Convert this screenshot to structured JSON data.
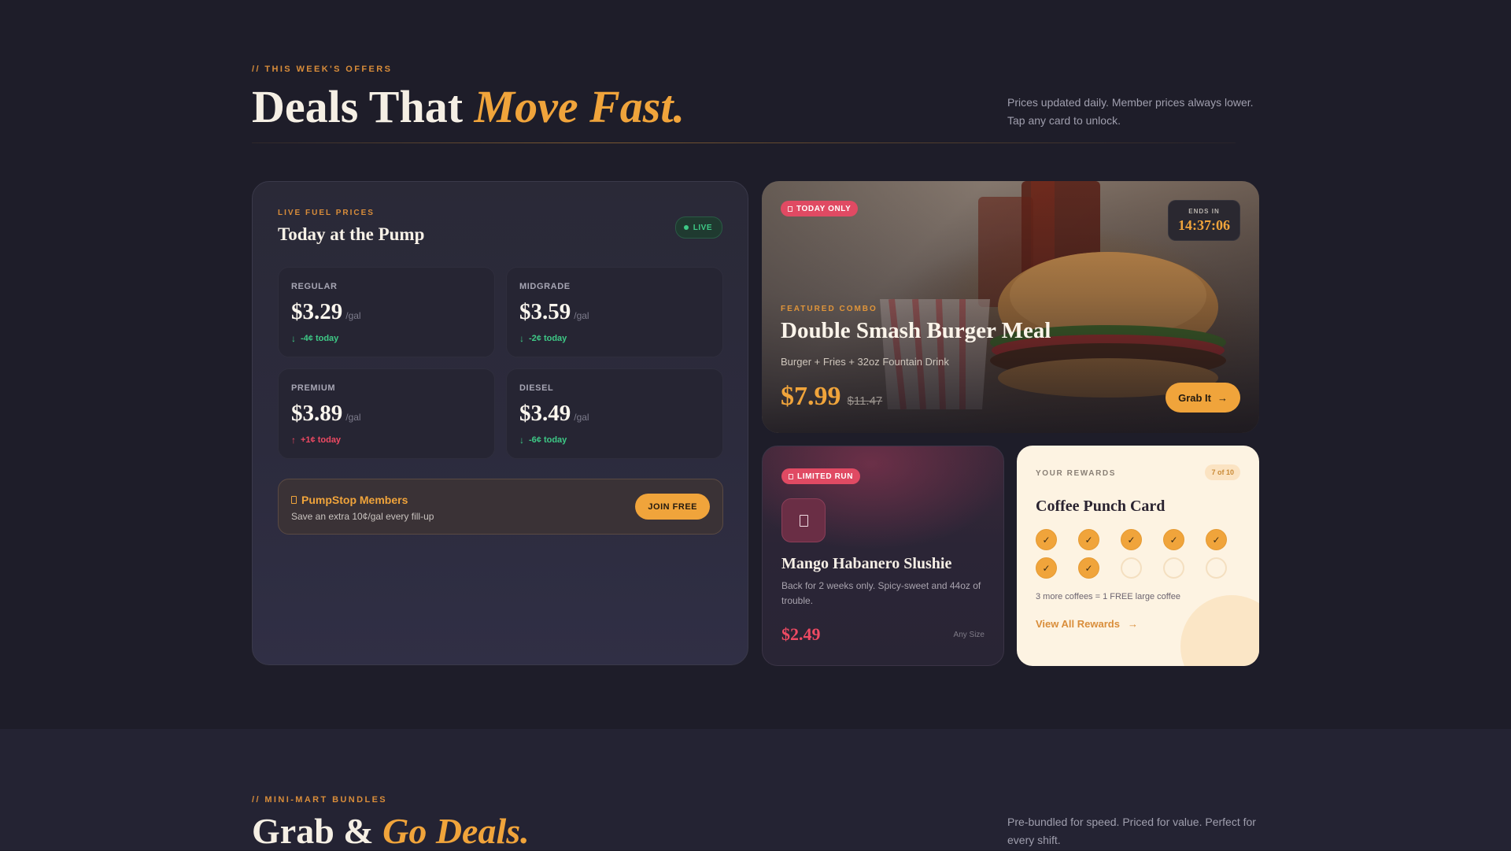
{
  "offers_section": {
    "eyebrow": "// THIS WEEK'S OFFERS",
    "title_plain": "Deals That ",
    "title_accent": "Move Fast.",
    "note": "Prices updated daily. Member prices always lower. Tap any card to unlock."
  },
  "fuel_card": {
    "eyebrow": "LIVE FUEL PRICES",
    "title": "Today at the Pump",
    "live_label": "LIVE",
    "prices": [
      {
        "grade": "REGULAR",
        "price": "$3.29",
        "unit": "/gal",
        "change": "-4¢ today",
        "direction": "down"
      },
      {
        "grade": "MIDGRADE",
        "price": "$3.59",
        "unit": "/gal",
        "change": "-2¢ today",
        "direction": "down"
      },
      {
        "grade": "PREMIUM",
        "price": "$3.89",
        "unit": "/gal",
        "change": "+1¢ today",
        "direction": "up"
      },
      {
        "grade": "DIESEL",
        "price": "$3.49",
        "unit": "/gal",
        "change": "-6¢ today",
        "direction": "down"
      }
    ],
    "members": {
      "title": "PumpStop Members",
      "subtitle": "Save an extra 10¢/gal every fill-up",
      "button": "JOIN FREE"
    }
  },
  "featured": {
    "tag": "TODAY ONLY",
    "ends_label": "ENDS IN",
    "ends_time": "14:37:06",
    "eyebrow": "FEATURED COMBO",
    "title": "Double Smash Burger Meal",
    "subtitle": "Burger + Fries + 32oz Fountain Drink",
    "price": "$7.99",
    "old_price": "$11.47",
    "button": "Grab It"
  },
  "slushie": {
    "tag": "LIMITED RUN",
    "icon": "cup-icon",
    "title": "Mango Habanero Slushie",
    "description": "Back for 2 weeks only. Spicy-sweet and 44oz of trouble.",
    "price": "$2.49",
    "size": "Any Size"
  },
  "rewards": {
    "eyebrow": "YOUR REWARDS",
    "badge": "7 of 10",
    "title": "Coffee Punch Card",
    "punches_total": 10,
    "punches_done": 7,
    "note": "3 more coffees = 1 FREE large coffee",
    "link": "View All Rewards"
  },
  "bundles_section": {
    "eyebrow": "// MINI-MART BUNDLES",
    "title_plain": "Grab & ",
    "title_accent": "Go Deals.",
    "note": "Pre-bundled for speed. Priced for value. Perfect for every shift."
  },
  "colors": {
    "background": "#1e1d29",
    "accent": "#f0a43b",
    "alert": "#ef4a63",
    "positive": "#3ec986",
    "cream": "#fdf3e2"
  }
}
